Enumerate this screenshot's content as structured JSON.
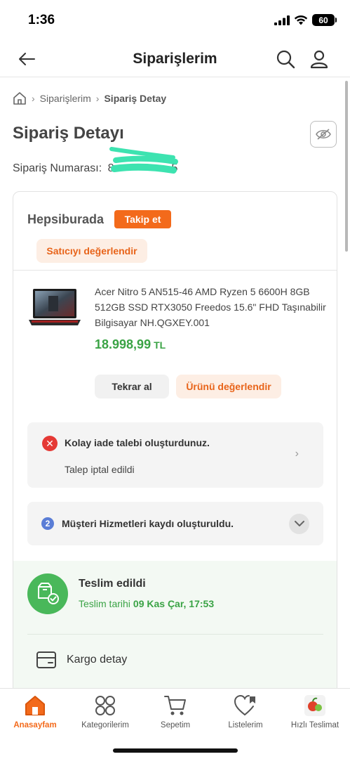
{
  "status_bar": {
    "time": "1:36",
    "battery": "60"
  },
  "nav": {
    "title": "Siparişlerim"
  },
  "breadcrumb": {
    "item1": "Siparişlerim",
    "current": "Sipariş Detay"
  },
  "page": {
    "title": "Sipariş Detayı",
    "order_number_label": "Sipariş Numarası:",
    "order_number_prefix": "8",
    "order_number_suffix": "5"
  },
  "seller": {
    "name": "Hepsiburada",
    "follow_label": "Takip et",
    "rate_label": "Satıcıyı değerlendir"
  },
  "product": {
    "name": "Acer Nitro 5 AN515-46 AMD Ryzen 5 6600H 8GB 512GB SSD RTX3050 Freedos 15.6\" FHD Taşınabilir Bilgisayar NH.QGXEY.001",
    "price": "18.998,99",
    "currency": "TL",
    "reorder_label": "Tekrar al",
    "rate_label": "Ürünü değerlendir"
  },
  "return_request": {
    "title": "Kolay iade talebi oluşturdunuz.",
    "status": "Talep iptal edildi"
  },
  "support": {
    "badge": "2",
    "title": "Müşteri Hizmetleri kaydı oluşturuldu."
  },
  "delivery": {
    "title": "Teslim edildi",
    "date_label": "Teslim tarihi",
    "date_value": "09 Kas Çar, 17:53",
    "cargo_label": "Kargo detay"
  },
  "bottom_nav": {
    "home": "Anasayfam",
    "categories": "Kategorilerim",
    "cart": "Sepetim",
    "lists": "Listelerim",
    "fast": "Hızlı Teslimat"
  },
  "colors": {
    "accent": "#f36a1b",
    "price_green": "#3aa345",
    "delivery_green": "#49b85a",
    "error_red": "#e53935"
  }
}
